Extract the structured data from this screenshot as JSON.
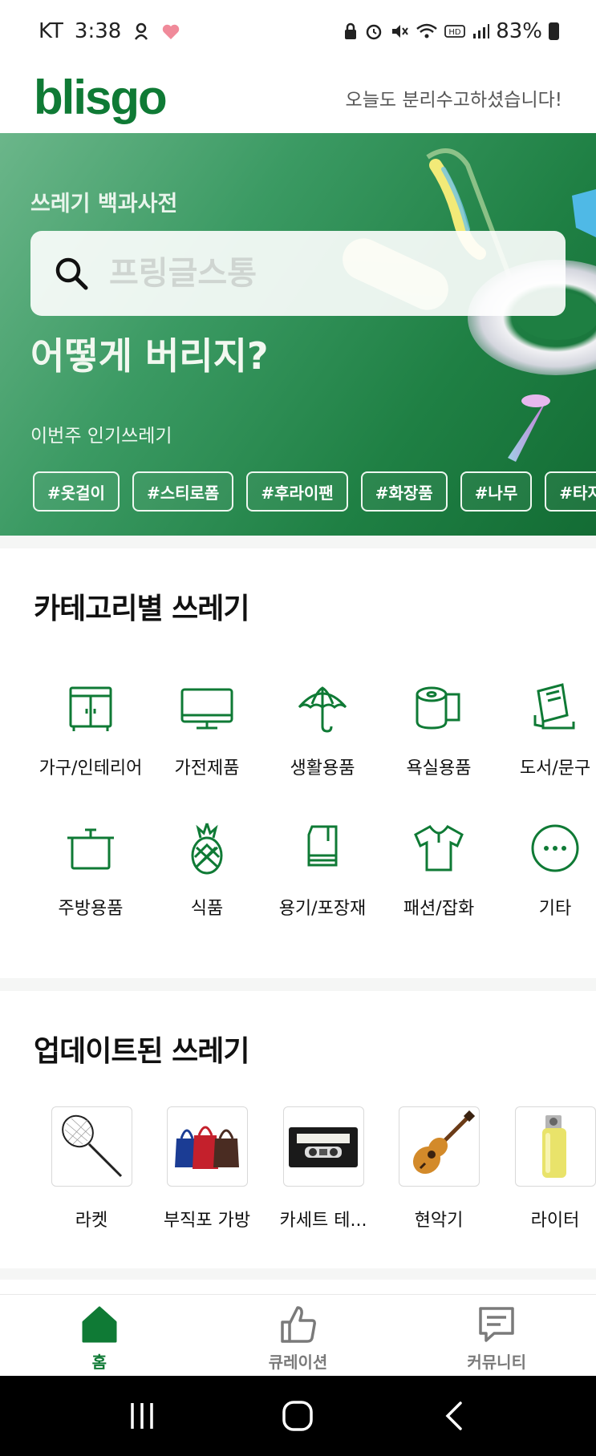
{
  "status_bar": {
    "carrier": "KT",
    "time": "3:38",
    "battery": "83%"
  },
  "header": {
    "logo": "blisgo",
    "greeting": "오늘도 분리수고하셨습니다!"
  },
  "hero": {
    "subtitle": "쓰레기 백과사전",
    "search_placeholder": "프링글스통",
    "question": "어떻게 버리지?",
    "popular_label": "이번주 인기쓰레기",
    "tags": [
      "#옷걸이",
      "#스티로폼",
      "#후라이팬",
      "#화장품",
      "#나무",
      "#타지않"
    ]
  },
  "categories": {
    "title": "카테고리별 쓰레기",
    "items": [
      {
        "label": "가구/인테리어",
        "icon": "furniture-icon"
      },
      {
        "label": "가전제품",
        "icon": "monitor-icon"
      },
      {
        "label": "생활용품",
        "icon": "umbrella-icon"
      },
      {
        "label": "욕실용품",
        "icon": "toilet-paper-icon"
      },
      {
        "label": "도서/문구",
        "icon": "books-icon"
      },
      {
        "label": "주방용품",
        "icon": "pot-icon"
      },
      {
        "label": "식품",
        "icon": "pineapple-icon"
      },
      {
        "label": "용기/포장재",
        "icon": "container-icon"
      },
      {
        "label": "패션/잡화",
        "icon": "shirt-icon"
      },
      {
        "label": "기타",
        "icon": "more-icon"
      }
    ]
  },
  "updated": {
    "title": "업데이트된 쓰레기",
    "items": [
      {
        "label": "라켓"
      },
      {
        "label": "부직포 가방"
      },
      {
        "label": "카세트 테..."
      },
      {
        "label": "현악기"
      },
      {
        "label": "라이터"
      }
    ]
  },
  "bottom_nav": {
    "items": [
      {
        "label": "홈",
        "icon": "home-icon",
        "active": true
      },
      {
        "label": "큐레이션",
        "icon": "thumbs-up-icon",
        "active": false
      },
      {
        "label": "커뮤니티",
        "icon": "chat-icon",
        "active": false
      }
    ]
  },
  "colors": {
    "brand": "#0f7a35",
    "hero_start": "#6bb68a",
    "hero_end": "#136c34"
  }
}
